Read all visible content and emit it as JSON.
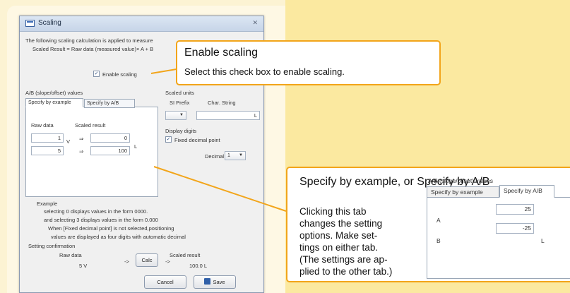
{
  "dialog": {
    "title": "Scaling",
    "close_glyph": "✕",
    "intro_line1": "The following scaling calculation is applied to measure",
    "intro_line2": "Scaled Result = Raw data (measured value)× A + B",
    "enable_label": "Enable scaling",
    "enable_checked": true,
    "ab_group_label": "A/B (slope/offset) values",
    "tab_example": "Specify by example",
    "tab_ab": "Specify by A/B",
    "raw_data_header": "Raw data",
    "scaled_result_header": "Scaled result",
    "row1": {
      "raw": "1",
      "raw_unit": "V",
      "arrow": "⇒",
      "scaled": "0"
    },
    "row2": {
      "raw": "5",
      "raw_unit": "V",
      "arrow": "⇒",
      "scaled": "100"
    },
    "scaled_unit_L": "L",
    "scaled_units_label": "Scaled units",
    "si_prefix_label": "SI Prefix",
    "char_string_label": "Char. String",
    "char_string_value": "L",
    "display_digits_label": "Display digits",
    "fixed_decimal_label": "Fixed decimal point",
    "fixed_decimal_checked": true,
    "decimal_label": "Decimal",
    "decimal_value": "1",
    "example_label": "Example",
    "example_line1": "selecting 0 displays values in the form 0000.",
    "example_line2": "and selecting 3 displays values in the form 0.000",
    "example_line3": "When [Fixed decimal point] is not selected,positioning",
    "example_line4": "values are displayed as four digits with automatic decimal",
    "confirm_label": "Setting confirmation",
    "confirm_raw_header": "Raw data",
    "confirm_scaled_header": "Scaled result",
    "confirm_raw_value": "5 V",
    "confirm_arrow_left": "->",
    "confirm_arrow_right": "->",
    "calc_label": "Calc",
    "confirm_scaled_value": "100.0 L",
    "cancel_label": "Cancel",
    "save_label": "Save"
  },
  "callout_enable": {
    "title": "Enable scaling",
    "desc": "Select this check box to enable scaling."
  },
  "callout_specify": {
    "title": "Specify by example, or Specify by A/B",
    "body_lines": [
      "Clicking this tab",
      "changes the setting",
      "options. Make set-",
      "tings on either tab.",
      "(The settings are ap-",
      "plied to the other tab.)"
    ],
    "mini": {
      "group_label": "A/B (slope/offset) values",
      "tab_example": "Specify by example",
      "tab_ab": "Specify by A/B",
      "a_label": "A",
      "a_value": "25",
      "b_label": "B",
      "b_value": "-25",
      "b_unit": "L"
    }
  },
  "colors": {
    "background": "#FBE9A0",
    "callout_border": "#F2A51A"
  }
}
